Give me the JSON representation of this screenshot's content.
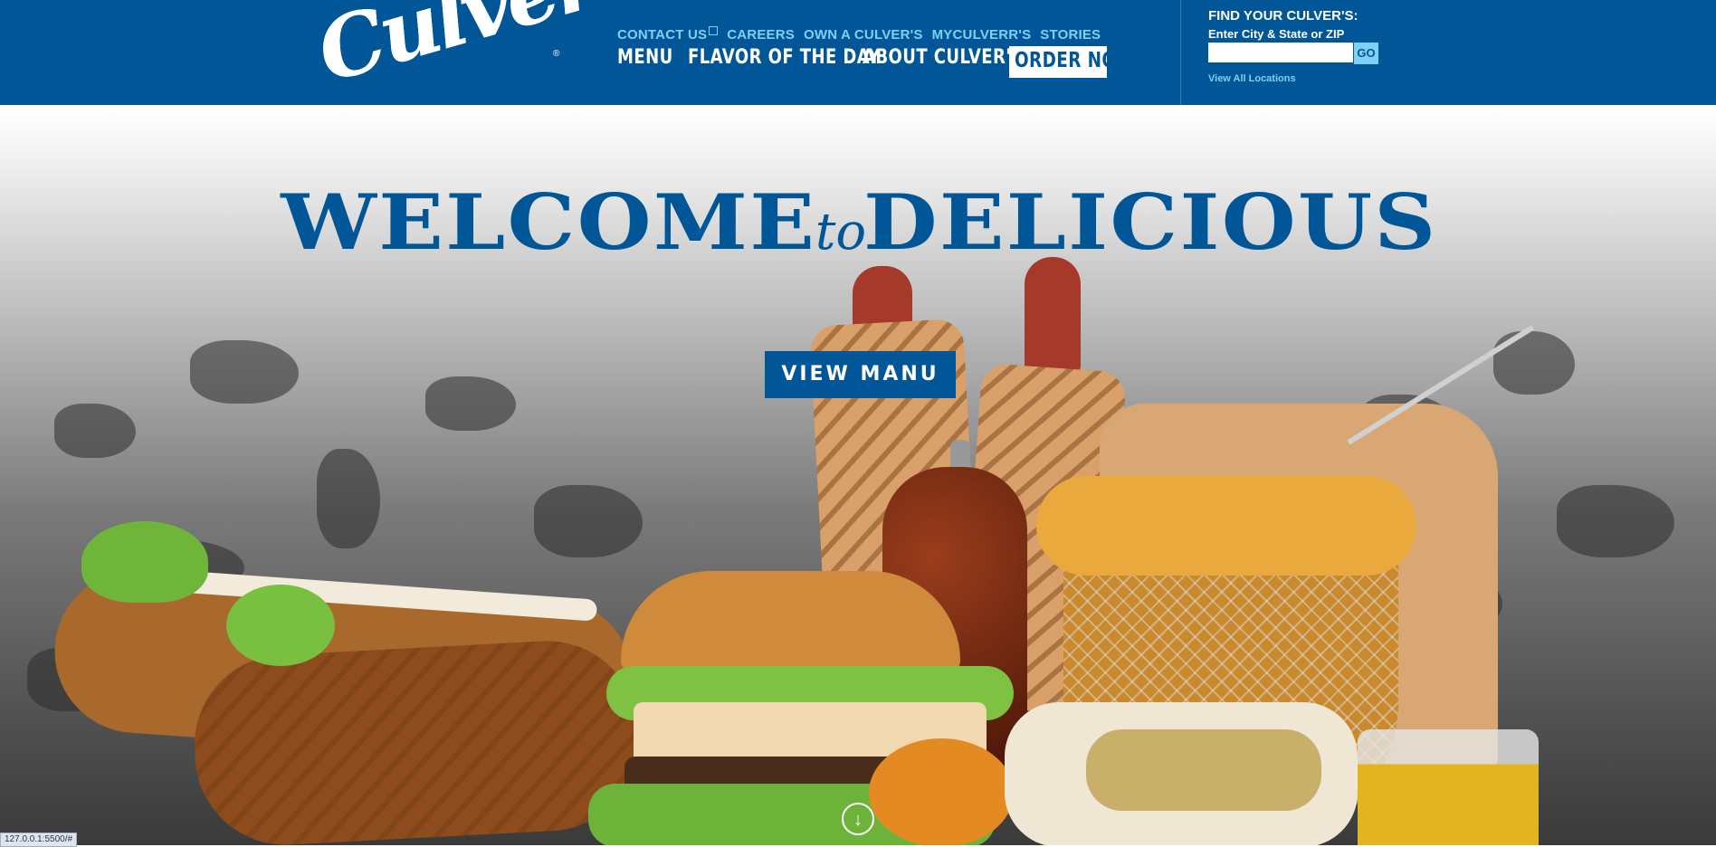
{
  "header": {
    "logo_text": "Culver's",
    "util_nav": [
      "CONTACT US",
      "CAREERS",
      "OWN A CULVER'S",
      "MYCULVERR'S",
      "STORIES"
    ],
    "main_nav": {
      "menu": "MENU",
      "flavor": "FLAVOR OF THE DAY",
      "about": "ABOUT CULVER'S",
      "order": "ORDER NOW"
    },
    "finder": {
      "title": "FIND YOUR CULVER'S:",
      "label": "Enter City & State or ZIP",
      "input_value": "",
      "go": "GO",
      "view_all": "View All Locations"
    }
  },
  "hero": {
    "headline_left": "WELCOME",
    "headline_to": "to",
    "headline_right": "DELICIOUS",
    "cta": "VIEW MANU",
    "scroll_icon": "arrow-down-circle-icon"
  },
  "status_bar": {
    "url": "127.0.0.1:5500/#"
  },
  "colors": {
    "brand_blue": "#005696",
    "light_blue": "#7fd0f5"
  }
}
